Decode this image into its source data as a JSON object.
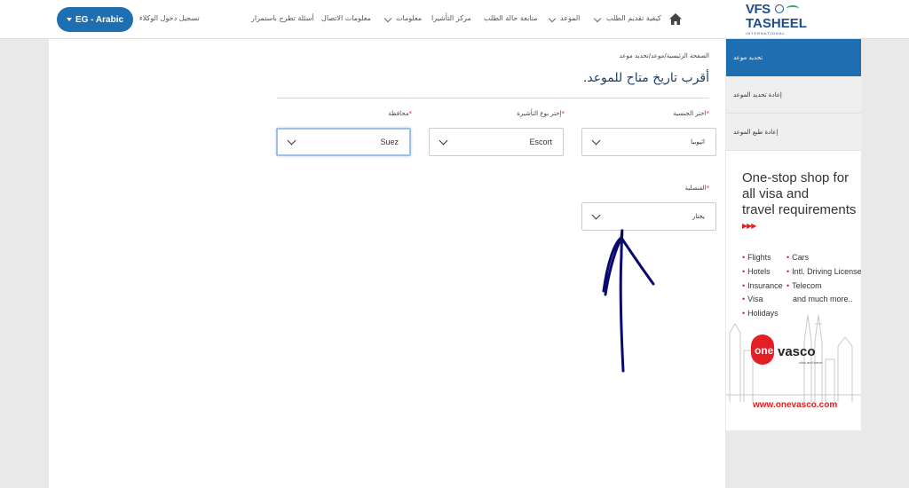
{
  "header": {
    "lang_button": "EG - Arabic",
    "agent_login": "تسجيل دخول الوكلاء",
    "nav": {
      "faq": "أسئلة تطرح باستمرار",
      "contact": "معلومات الاتصال",
      "info": "معلومات",
      "visa_center": "مركز التأشيرا",
      "track": "متابعة حالة الطلب",
      "appointment": "الموعد",
      "how_to_apply": "كيفية تقديم الطلب"
    },
    "logo": {
      "vfs": "VFS",
      "tasheel": "TASHEEL",
      "intl": "INTERNATIONAL"
    }
  },
  "main": {
    "breadcrumb": "الصفحة الرئيسية/موعد/تحديد موعد",
    "title": "أقرب تاريخ متاح للموعد.",
    "fields": {
      "nationality": {
        "label": "اختر الجنسية",
        "required": "*",
        "value": "اثيوبيا"
      },
      "visa_type": {
        "label": "إختر نوع التأشيرة",
        "required": "*",
        "value": "Escort"
      },
      "governorate": {
        "label": "محافظة",
        "required": "*",
        "value": "Suez"
      },
      "consulate": {
        "label": "القنصلية",
        "required": "*",
        "value": "يختار"
      }
    }
  },
  "sidebar": {
    "items": [
      {
        "label": "تحديد موعد"
      },
      {
        "label": "إعادة تحديد الموعد"
      },
      {
        "label": "إعادة طبع الموعد"
      }
    ]
  },
  "ad": {
    "title": "One-stop shop for\nall visa and\ntravel requirements",
    "arrows": "▶▶▶",
    "left_items": [
      "Flights",
      "Hotels",
      "Insurance",
      "Visa",
      "Holidays"
    ],
    "right_items": [
      "Cars",
      "Intl. Driving License",
      "Telecom"
    ],
    "more": "and much more..",
    "brand_one": "one",
    "brand_vasco": "vasco",
    "tagline": "click and travel",
    "url": "www.onevasco.com"
  },
  "colors": {
    "accent": "#1d6fb1",
    "required": "#dd2222",
    "annotation": "#0a0a6e",
    "ad_red": "#e11f25"
  }
}
